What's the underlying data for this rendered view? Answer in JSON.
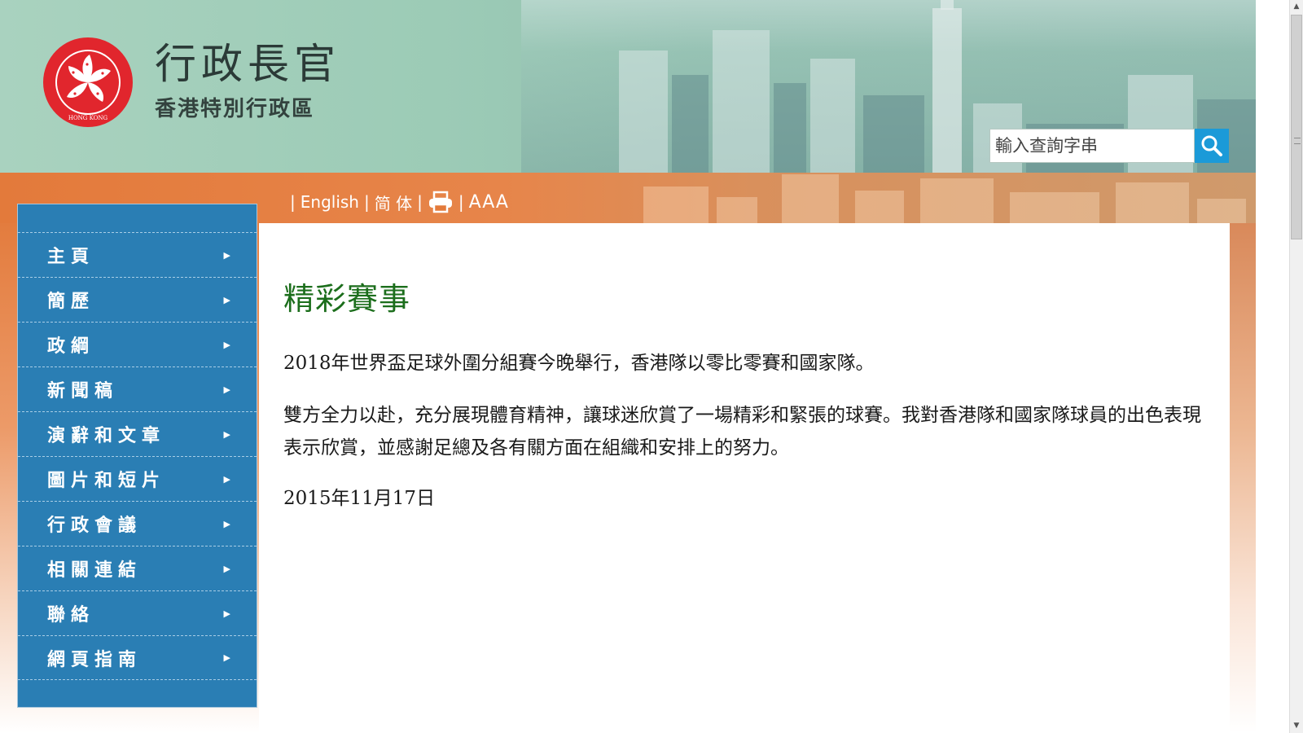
{
  "header": {
    "title": "行政長官",
    "subtitle": "香港特別行政區",
    "emblem_text": "中華人民共和國香港特別行政區 HONG KONG",
    "search": {
      "placeholder": "輸入查詢字串",
      "value": ""
    }
  },
  "toolbar": {
    "english": "English",
    "simplified": "简 体",
    "text_size": "AAA",
    "separator": "|"
  },
  "sidebar": {
    "items": [
      {
        "label": "主頁"
      },
      {
        "label": "簡歷"
      },
      {
        "label": "政綱"
      },
      {
        "label": "新聞稿"
      },
      {
        "label": "演辭和文章"
      },
      {
        "label": "圖片和短片"
      },
      {
        "label": "行政會議"
      },
      {
        "label": "相關連結"
      },
      {
        "label": "聯絡"
      },
      {
        "label": "網頁指南"
      }
    ],
    "arrow": "▶"
  },
  "main": {
    "title": "精彩賽事",
    "paragraph1": "2018年世界盃足球外圍分組賽今晚舉行，香港隊以零比零賽和國家隊。",
    "paragraph2": "雙方全力以赴，充分展現體育精神，讓球迷欣賞了一場精彩和緊張的球賽。我對香港隊和國家隊球員的出色表現表示欣賞，並感謝足總及各有關方面在組織和安排上的努力。",
    "date": "2015年11月17日"
  },
  "colors": {
    "banner_green": "#9ccbb6",
    "band_orange": "#e37a3b",
    "sidebar_blue": "#2a7eb4",
    "title_green": "#1c6e1c",
    "search_button": "#1b9ad8"
  },
  "icons": {
    "search": "search-icon",
    "print": "printer-icon",
    "emblem": "bauhinia-emblem"
  }
}
